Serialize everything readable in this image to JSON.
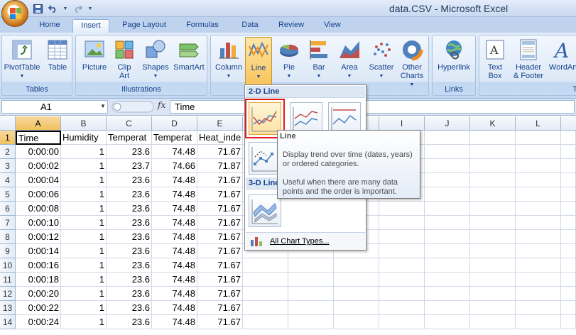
{
  "window": {
    "title": "data.CSV - Microsoft Excel"
  },
  "qat": {
    "save": "save-icon",
    "undo": "undo-icon",
    "redo": "redo-icon",
    "more": "customize-icon"
  },
  "tabs": [
    {
      "label": "Home"
    },
    {
      "label": "Insert",
      "active": true
    },
    {
      "label": "Page Layout"
    },
    {
      "label": "Formulas"
    },
    {
      "label": "Data"
    },
    {
      "label": "Review"
    },
    {
      "label": "View"
    }
  ],
  "ribbon": {
    "tables": {
      "label": "Tables",
      "pivottable": "PivotTable",
      "table": "Table"
    },
    "illustrations": {
      "label": "Illustrations",
      "picture": "Picture",
      "clip_art_1": "Clip",
      "clip_art_2": "Art",
      "shapes": "Shapes",
      "smartart": "SmartArt"
    },
    "charts": {
      "column": "Column",
      "line": "Line",
      "pie": "Pie",
      "bar": "Bar",
      "area": "Area",
      "scatter": "Scatter",
      "other_1": "Other",
      "other_2": "Charts"
    },
    "links": {
      "label": "Links",
      "hyperlink": "Hyperlink"
    },
    "text": {
      "textbox_1": "Text",
      "textbox_2": "Box",
      "header_1": "Header",
      "header_2": "& Footer",
      "wordart": "WordArt",
      "group_initial": "T"
    }
  },
  "formula_bar": {
    "name_box": "A1",
    "fx": "fx",
    "value": "Time"
  },
  "grid": {
    "columns": [
      "A",
      "B",
      "C",
      "D",
      "E",
      "F",
      "G",
      "H",
      "I",
      "J",
      "K",
      "L"
    ],
    "header_row": [
      "Time",
      "Humidity",
      "Temperat",
      "Temperat",
      "Heat_inde"
    ],
    "rows": [
      [
        "0:00:00",
        "1",
        "23.6",
        "74.48",
        "71.67"
      ],
      [
        "0:00:02",
        "1",
        "23.7",
        "74.66",
        "71.87"
      ],
      [
        "0:00:04",
        "1",
        "23.6",
        "74.48",
        "71.67"
      ],
      [
        "0:00:06",
        "1",
        "23.6",
        "74.48",
        "71.67"
      ],
      [
        "0:00:08",
        "1",
        "23.6",
        "74.48",
        "71.67"
      ],
      [
        "0:00:10",
        "1",
        "23.6",
        "74.48",
        "71.67"
      ],
      [
        "0:00:12",
        "1",
        "23.6",
        "74.48",
        "71.67"
      ],
      [
        "0:00:14",
        "1",
        "23.6",
        "74.48",
        "71.67"
      ],
      [
        "0:00:16",
        "1",
        "23.6",
        "74.48",
        "71.67"
      ],
      [
        "0:00:18",
        "1",
        "23.6",
        "74.48",
        "71.67"
      ],
      [
        "0:00:20",
        "1",
        "23.6",
        "74.48",
        "71.67"
      ],
      [
        "0:00:22",
        "1",
        "23.6",
        "74.48",
        "71.67"
      ],
      [
        "0:00:24",
        "1",
        "23.6",
        "74.48",
        "71.67"
      ]
    ],
    "row_numbers": [
      "1",
      "2",
      "3",
      "4",
      "5",
      "6",
      "7",
      "8",
      "9",
      "10",
      "11",
      "12",
      "13",
      "14"
    ]
  },
  "dropdown": {
    "section_2d": "2-D Line",
    "section_3d": "3-D Line",
    "footer": "All Chart Types..."
  },
  "tooltip": {
    "title": "Line",
    "line1": "Display trend over time (dates, years) or ordered categories.",
    "line2": "Useful when there are many data points and the order is important."
  },
  "colors": {
    "accent": "#15428b",
    "highlight": "#e21a1a",
    "pressed": "#f8c45c"
  }
}
